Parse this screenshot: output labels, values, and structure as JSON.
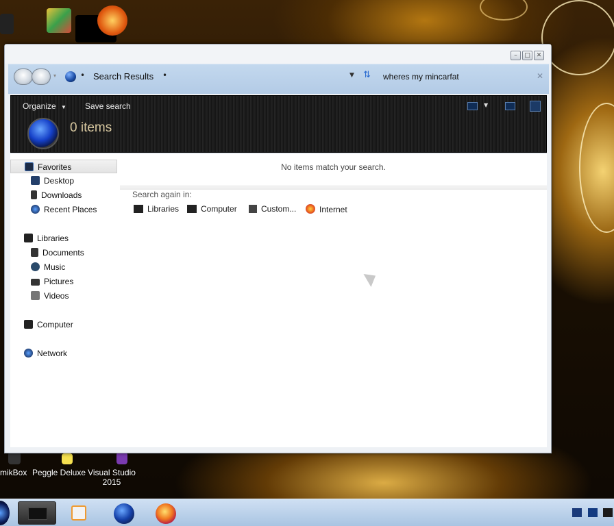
{
  "window": {
    "address_title": "Search Results",
    "search_query": "wheres my mincarfat",
    "toolbar": {
      "organize": "Organize",
      "save_search": "Save search",
      "items_count": "0 items"
    },
    "sidebar": {
      "favorites": "Favorites",
      "desktop": "Desktop",
      "downloads": "Downloads",
      "recent_places": "Recent Places",
      "libraries": "Libraries",
      "documents": "Documents",
      "music": "Music",
      "pictures": "Pictures",
      "videos": "Videos",
      "computer": "Computer",
      "network": "Network"
    },
    "content": {
      "no_items_message": "No items match your search.",
      "search_again_label": "Search again in:",
      "locations": [
        "Libraries",
        "Computer",
        "Custom...",
        "Internet"
      ]
    }
  },
  "desktop_icons": {
    "mikbox": "mikBox",
    "peggle": "Peggle Deluxe",
    "visual_studio_line1": "Visual Studio",
    "visual_studio_line2": "2015"
  },
  "colors": {
    "address_bar": "#b8cfe9",
    "toolbar_dark": "#1a1a1a",
    "taskbar": "#bdd3ec"
  },
  "icons": [
    "back-icon",
    "forward-icon",
    "globe-icon",
    "refresh-icon",
    "close-icon",
    "minimize-icon",
    "maximize-icon",
    "folder-icon",
    "music-icon",
    "firefox-icon",
    "media-player-icon"
  ]
}
